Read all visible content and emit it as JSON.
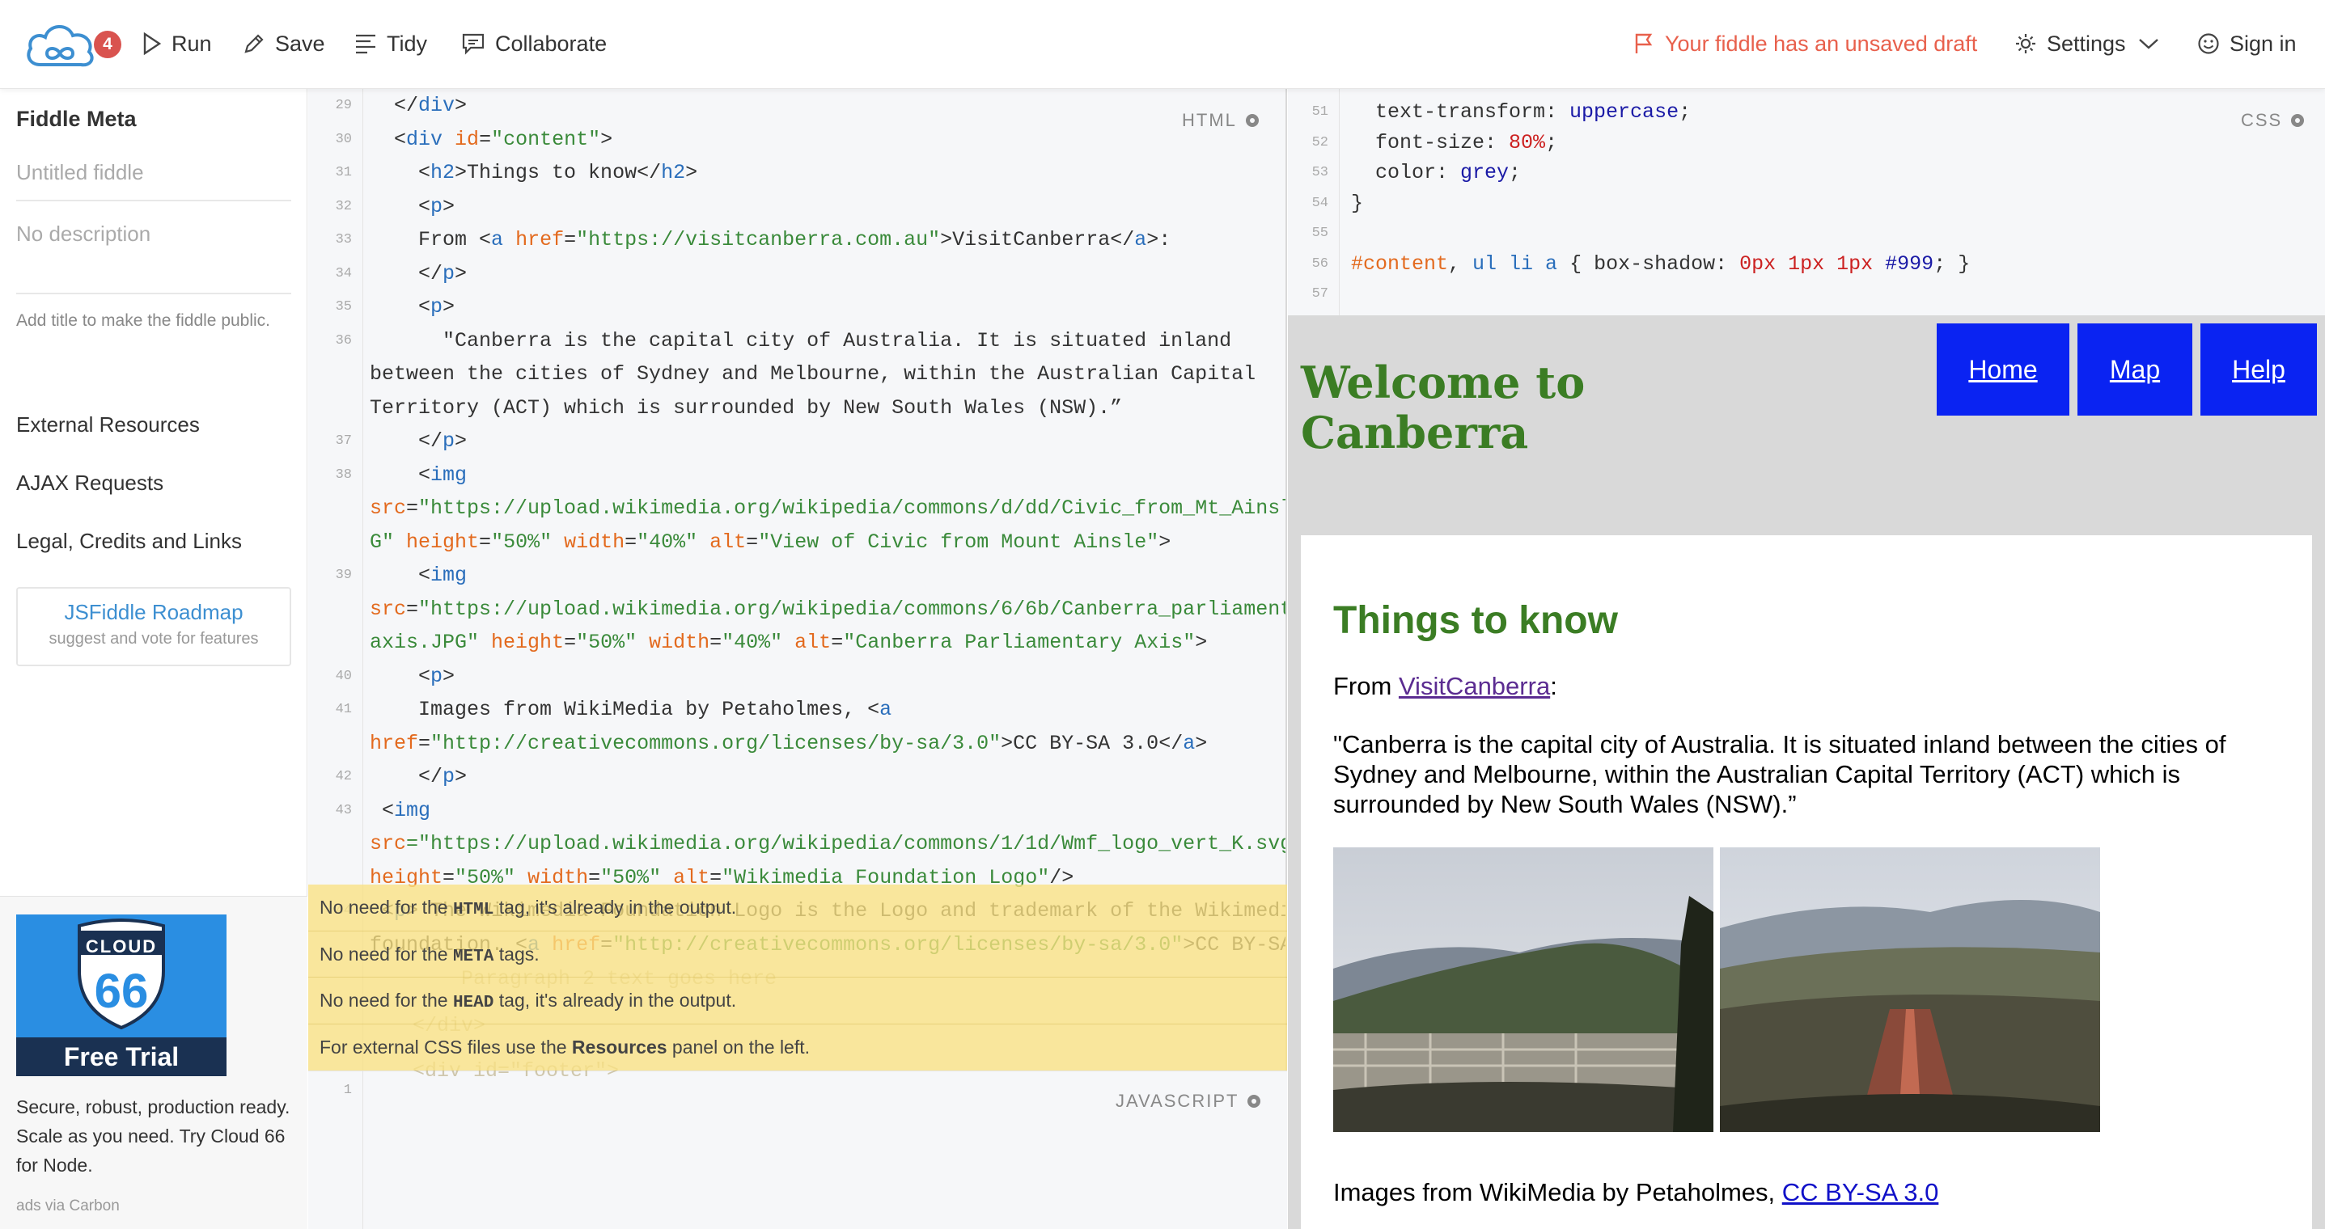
{
  "topbar": {
    "badge_count": "4",
    "run": "Run",
    "save": "Save",
    "tidy": "Tidy",
    "collaborate": "Collaborate",
    "draft_notice": "Your fiddle has an unsaved draft",
    "settings": "Settings",
    "sign_in": "Sign in"
  },
  "sidebar": {
    "title": "Fiddle Meta",
    "title_placeholder": "Untitled fiddle",
    "desc_placeholder": "No description",
    "hint": "Add title to make the fiddle public.",
    "links": [
      "External Resources",
      "AJAX Requests",
      "Legal, Credits and Links"
    ],
    "roadmap_title": "JSFiddle Roadmap",
    "roadmap_sub": "suggest and vote for features",
    "ad": {
      "logo_top": "CLOUD",
      "logo_num": "66",
      "trial": "Free Trial",
      "text": "Secure, robust, production ready. Scale as you need. Try Cloud 66 for Node.",
      "via": "ads via Carbon"
    }
  },
  "html_panel": {
    "label": "HTML",
    "lines": [
      {
        "n": "29",
        "segs": [
          [
            "p",
            "  </"
          ],
          [
            "t",
            "div"
          ],
          [
            "p",
            ">"
          ]
        ]
      },
      {
        "n": "30",
        "segs": [
          [
            "p",
            "  <"
          ],
          [
            "t",
            "div"
          ],
          [
            "p",
            " "
          ],
          [
            "a",
            "id"
          ],
          [
            "p",
            "="
          ],
          [
            "s",
            "\"content\""
          ],
          [
            "p",
            ">"
          ]
        ]
      },
      {
        "n": "31",
        "segs": [
          [
            "p",
            "    <"
          ],
          [
            "t",
            "h2"
          ],
          [
            "p",
            ">Things to know</"
          ],
          [
            "t",
            "h2"
          ],
          [
            "p",
            ">"
          ]
        ]
      },
      {
        "n": "32",
        "segs": [
          [
            "p",
            "    <"
          ],
          [
            "t",
            "p"
          ],
          [
            "p",
            ">"
          ]
        ]
      },
      {
        "n": "33",
        "segs": [
          [
            "p",
            "    From <"
          ],
          [
            "t",
            "a"
          ],
          [
            "p",
            " "
          ],
          [
            "a",
            "href"
          ],
          [
            "p",
            "="
          ],
          [
            "s",
            "\"https://visitcanberra.com.au\""
          ],
          [
            "p",
            ">VisitCanberra</"
          ],
          [
            "t",
            "a"
          ],
          [
            "p",
            ">:"
          ]
        ]
      },
      {
        "n": "34",
        "segs": [
          [
            "p",
            "    </"
          ],
          [
            "t",
            "p"
          ],
          [
            "p",
            ">"
          ]
        ]
      },
      {
        "n": "35",
        "segs": [
          [
            "p",
            "    <"
          ],
          [
            "t",
            "p"
          ],
          [
            "p",
            ">"
          ]
        ]
      },
      {
        "n": "36",
        "segs": [
          [
            "p",
            "      \"Canberra is the capital city of Australia. It is situated inland"
          ]
        ]
      },
      {
        "n": "",
        "segs": [
          [
            "p",
            "between the cities of Sydney and Melbourne, within the Australian Capital"
          ]
        ]
      },
      {
        "n": "",
        "segs": [
          [
            "p",
            "Territory (ACT) which is surrounded by New South Wales (NSW).”"
          ]
        ]
      },
      {
        "n": "37",
        "segs": [
          [
            "p",
            "    </"
          ],
          [
            "t",
            "p"
          ],
          [
            "p",
            ">"
          ]
        ]
      },
      {
        "n": "38",
        "segs": [
          [
            "p",
            "    <"
          ],
          [
            "t",
            "img"
          ]
        ]
      },
      {
        "n": "",
        "segs": [
          [
            "a",
            "src"
          ],
          [
            "p",
            "="
          ],
          [
            "s",
            "\"https://upload.wikimedia.org/wikipedia/commons/d/dd/Civic_from_Mt_Ainsle.JP"
          ]
        ]
      },
      {
        "n": "",
        "segs": [
          [
            "s",
            "G\""
          ],
          [
            "p",
            " "
          ],
          [
            "a",
            "height"
          ],
          [
            "p",
            "="
          ],
          [
            "s",
            "\"50%\""
          ],
          [
            "p",
            " "
          ],
          [
            "a",
            "width"
          ],
          [
            "p",
            "="
          ],
          [
            "s",
            "\"40%\""
          ],
          [
            "p",
            " "
          ],
          [
            "a",
            "alt"
          ],
          [
            "p",
            "="
          ],
          [
            "s",
            "\"View of Civic from Mount Ainsle\""
          ],
          [
            "p",
            ">"
          ]
        ]
      },
      {
        "n": "39",
        "segs": [
          [
            "p",
            "    <"
          ],
          [
            "t",
            "img"
          ]
        ]
      },
      {
        "n": "",
        "segs": [
          [
            "a",
            "src"
          ],
          [
            "p",
            "="
          ],
          [
            "s",
            "\"https://upload.wikimedia.org/wikipedia/commons/6/6b/Canberra_parliamentary_"
          ]
        ]
      },
      {
        "n": "",
        "segs": [
          [
            "s",
            "axis.JPG\""
          ],
          [
            "p",
            " "
          ],
          [
            "a",
            "height"
          ],
          [
            "p",
            "="
          ],
          [
            "s",
            "\"50%\""
          ],
          [
            "p",
            " "
          ],
          [
            "a",
            "width"
          ],
          [
            "p",
            "="
          ],
          [
            "s",
            "\"40%\""
          ],
          [
            "p",
            " "
          ],
          [
            "a",
            "alt"
          ],
          [
            "p",
            "="
          ],
          [
            "s",
            "\"Canberra Parliamentary Axis\""
          ],
          [
            "p",
            ">"
          ]
        ]
      },
      {
        "n": "40",
        "segs": [
          [
            "p",
            "    <"
          ],
          [
            "t",
            "p"
          ],
          [
            "p",
            ">"
          ]
        ]
      },
      {
        "n": "41",
        "segs": [
          [
            "p",
            "    Images from WikiMedia by Petaholmes, <"
          ],
          [
            "t",
            "a"
          ]
        ]
      },
      {
        "n": "",
        "segs": [
          [
            "a",
            "href"
          ],
          [
            "p",
            "="
          ],
          [
            "s",
            "\"http://creativecommons.org/licenses/by-sa/3.0\""
          ],
          [
            "p",
            ">CC BY-SA 3.0</"
          ],
          [
            "t",
            "a"
          ],
          [
            "p",
            ">"
          ]
        ]
      },
      {
        "n": "42",
        "segs": [
          [
            "p",
            "    </"
          ],
          [
            "t",
            "p"
          ],
          [
            "p",
            ">"
          ]
        ]
      },
      {
        "n": "43",
        "segs": [
          [
            "p",
            " <"
          ],
          [
            "t",
            "img"
          ]
        ]
      },
      {
        "n": "",
        "segs": [
          [
            "a",
            "src"
          ],
          [
            "s",
            "=\"https://upload.wikimedia.org/wikipedia/commons/1/1d/Wmf_logo_vert_K.svg\""
          ]
        ]
      },
      {
        "n": "",
        "segs": [
          [
            "a",
            "height"
          ],
          [
            "p",
            "="
          ],
          [
            "s",
            "\"50%\""
          ],
          [
            "p",
            " "
          ],
          [
            "a",
            "width"
          ],
          [
            "p",
            "="
          ],
          [
            "s",
            "\"50%\""
          ],
          [
            "p",
            " "
          ],
          [
            "a",
            "alt"
          ],
          [
            "p",
            "="
          ],
          [
            "s",
            "\"Wikimedia Foundation Logo\""
          ],
          [
            "p",
            "/>"
          ]
        ]
      },
      {
        "n": "44",
        "segs": [
          [
            "p",
            " <"
          ],
          [
            "t",
            "p"
          ],
          [
            "p",
            "> The Wikimedia Foundation Logo is the Logo and trademark of the Wikimedia"
          ]
        ]
      },
      {
        "n": "",
        "segs": [
          [
            "p",
            "foundation. <"
          ],
          [
            "t",
            "a"
          ],
          [
            "p",
            " "
          ],
          [
            "a",
            "href"
          ],
          [
            "p",
            "="
          ],
          [
            "s",
            "\"http://creativecommons.org/licenses/by-sa/3.0\""
          ],
          [
            "p",
            ">CC BY-SA"
          ]
        ]
      }
    ],
    "ghost_lines": [
      "Paragraph 2 text goes here",
      "</div>",
      "<div id=\"footer\">"
    ]
  },
  "warnings": [
    {
      "pre": "No need for the ",
      "code": "HTML",
      "post": " tag, it's already in the output."
    },
    {
      "pre": "No need for the ",
      "code": "META",
      "post": " tags."
    },
    {
      "pre": "No need for the ",
      "code": "HEAD",
      "post": " tag, it's already in the output."
    },
    {
      "pre": "For external CSS files use the ",
      "bold": "Resources",
      "post": " panel on the left."
    }
  ],
  "js_panel": {
    "label": "JAVASCRIPT",
    "line_number": "1"
  },
  "css_panel": {
    "label": "CSS",
    "lines": [
      {
        "n": "51",
        "segs": [
          [
            "p",
            "  text-transform: "
          ],
          [
            "kw",
            "uppercase"
          ],
          [
            "p",
            ";"
          ]
        ]
      },
      {
        "n": "52",
        "segs": [
          [
            "p",
            "  font-size: "
          ],
          [
            "num",
            "80%"
          ],
          [
            "p",
            ";"
          ]
        ]
      },
      {
        "n": "53",
        "segs": [
          [
            "p",
            "  color: "
          ],
          [
            "kw",
            "grey"
          ],
          [
            "p",
            ";"
          ]
        ]
      },
      {
        "n": "54",
        "segs": [
          [
            "p",
            "}"
          ]
        ]
      },
      {
        "n": "55",
        "segs": [
          [
            "p",
            ""
          ]
        ]
      },
      {
        "n": "56",
        "segs": [
          [
            "sel",
            "#content"
          ],
          [
            "p",
            ", "
          ],
          [
            "cl",
            "ul li a"
          ],
          [
            "p",
            " { box-shadow: "
          ],
          [
            "num",
            "0px 1px 1px"
          ],
          [
            "p",
            " "
          ],
          [
            "hex",
            "#999"
          ],
          [
            "p",
            "; }"
          ]
        ]
      },
      {
        "n": "57",
        "segs": [
          [
            "p",
            ""
          ]
        ]
      }
    ]
  },
  "result": {
    "heading": "Welcome to Canberra",
    "nav": [
      "Home",
      "Map",
      "Help"
    ],
    "h2": "Things to know",
    "from_prefix": "From ",
    "from_link": "VisitCanberra",
    "from_suffix": ":",
    "quote": "\"Canberra is the capital city of Australia. It is situated inland between the cities of Sydney and Melbourne, within the Australian Capital Territory (ACT) which is surrounded by New South Wales (NSW).”",
    "credits_prefix": "Images from WikiMedia by Petaholmes, ",
    "credits_link": "CC BY-SA 3.0"
  },
  "colors": {
    "accent_green": "#3b7d24",
    "nav_blue": "#0a23f2",
    "draft_red": "#e8604c",
    "link_blue": "#3d8fd1"
  }
}
